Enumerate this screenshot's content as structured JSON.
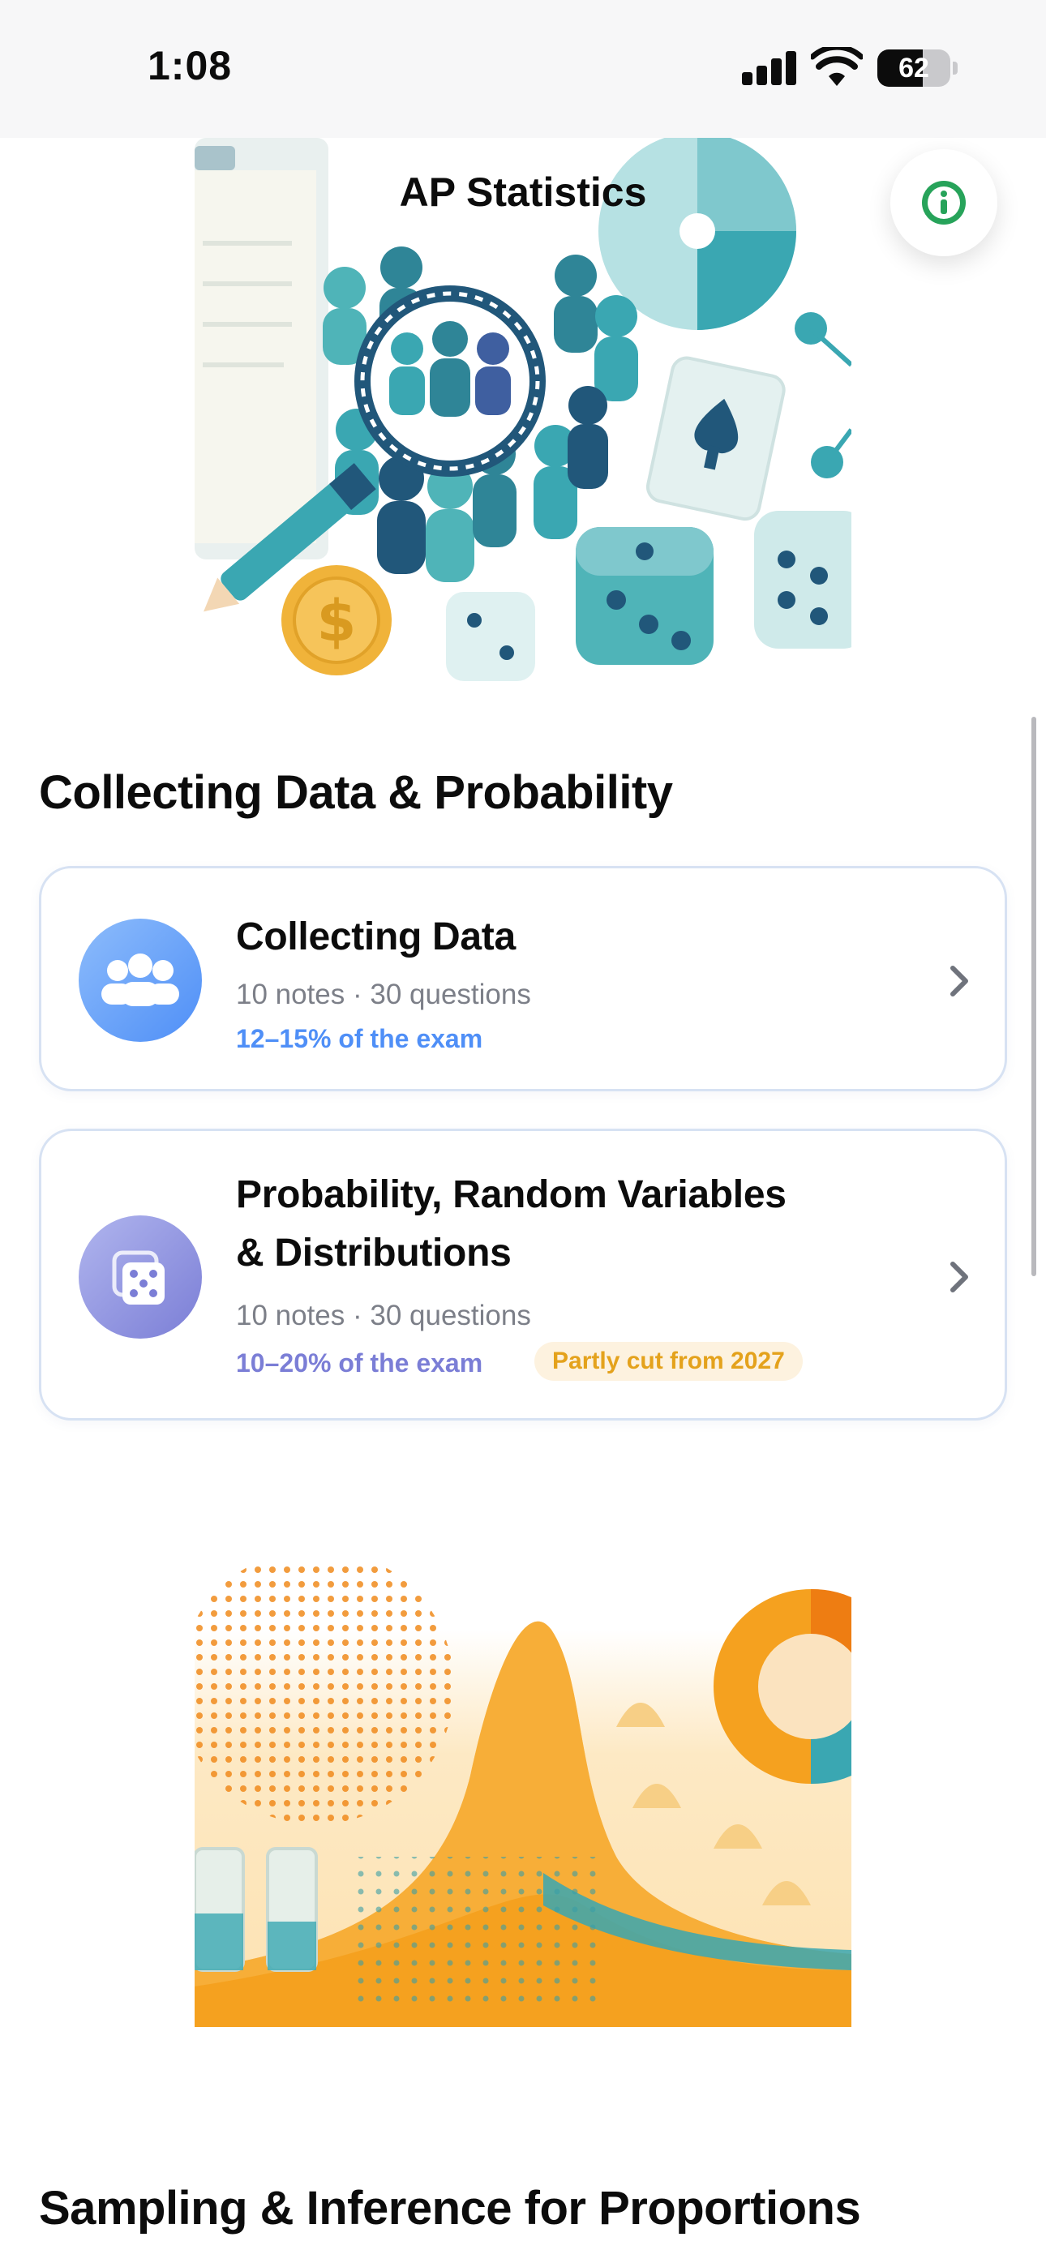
{
  "status_bar": {
    "time": "1:08",
    "battery_level": "62"
  },
  "header": {
    "title": "AP Statistics",
    "info_icon": "info-circle-icon"
  },
  "sections": [
    {
      "title": "Collecting Data & Probability",
      "units": [
        {
          "title": "Collecting Data",
          "meta": "10 notes · 30 questions",
          "exam_weight": "12–15% of the exam",
          "icon": "group-people-icon",
          "accent": "#4f8ff7"
        },
        {
          "title_line1": "Probability, Random Variables",
          "title_line2": "& Distributions",
          "meta": "10 notes · 30 questions",
          "exam_weight": "10–20% of the exam",
          "badge": "Partly cut from 2027",
          "icon": "dice-icon",
          "accent": "#7b7ed6"
        }
      ]
    },
    {
      "title": "Sampling & Inference for Proportions"
    }
  ],
  "colors": {
    "teal": "#3aa7b2",
    "navy": "#21577a",
    "orange": "#f5a11f",
    "badge_text": "#e4a21c",
    "badge_bg": "#fdf2df"
  }
}
